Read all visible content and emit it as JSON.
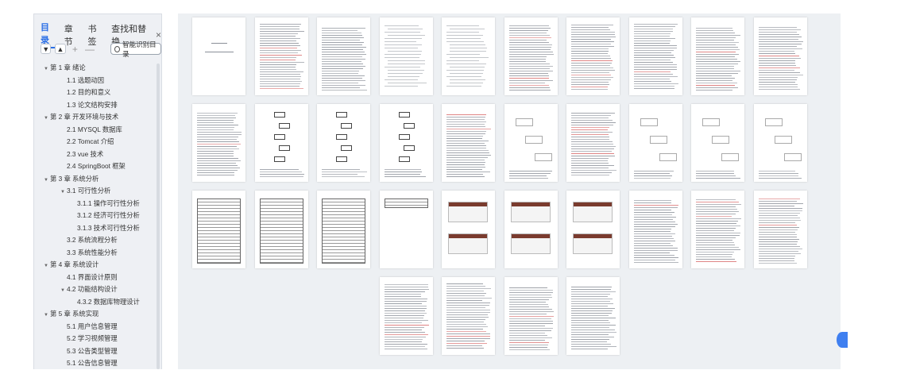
{
  "sidebar": {
    "tabs": [
      {
        "label": "目录",
        "active": true
      },
      {
        "label": "章节",
        "active": false
      },
      {
        "label": "书签",
        "active": false
      },
      {
        "label": "查找和替换",
        "active": false
      }
    ],
    "close_label": "×",
    "tools": {
      "expand_icon": "chevron-down-icon",
      "collapse_icon": "chevron-up-icon",
      "add_label": "+",
      "remove_label": "—",
      "smart_label": "智能识别目录"
    },
    "toc": [
      {
        "label": "第 1 章  绪论",
        "level": 0,
        "expanded": true
      },
      {
        "label": "1.1 选题动因",
        "level": 1
      },
      {
        "label": "1.2 目的和意义",
        "level": 1
      },
      {
        "label": "1.3 论文结构安排",
        "level": 1
      },
      {
        "label": "第 2 章  开发环境与技术",
        "level": 0,
        "expanded": true
      },
      {
        "label": "2.1 MYSQL 数据库",
        "level": 1
      },
      {
        "label": "2.2 Tomcat  介绍",
        "level": 1
      },
      {
        "label": "2.3 vue 技术",
        "level": 1
      },
      {
        "label": "2.4 SpringBoot 框架",
        "level": 1
      },
      {
        "label": "第 3 章  系统分析",
        "level": 0,
        "expanded": true
      },
      {
        "label": "3.1 可行性分析",
        "level": 1,
        "expanded": true
      },
      {
        "label": "3.1.1 操作可行性分析",
        "level": 2
      },
      {
        "label": "3.1.2 经济可行性分析",
        "level": 2
      },
      {
        "label": "3.1.3 技术可行性分析",
        "level": 2
      },
      {
        "label": "3.2 系统流程分析",
        "level": 1
      },
      {
        "label": "3.3 系统性能分析",
        "level": 1
      },
      {
        "label": "第 4 章  系统设计",
        "level": 0,
        "expanded": true
      },
      {
        "label": "4.1 界面设计原则",
        "level": 1
      },
      {
        "label": "4.2 功能结构设计",
        "level": 1,
        "expanded": true
      },
      {
        "label": "4.3.2  数据库物理设计",
        "level": 2
      },
      {
        "label": "第 5 章  系统实现",
        "level": 0,
        "expanded": true
      },
      {
        "label": "5.1 用户信息管理",
        "level": 1
      },
      {
        "label": "5.2  学习视频管理",
        "level": 1
      },
      {
        "label": "5.3 公告类型管理",
        "level": 1
      },
      {
        "label": "5.1 公告信息管理",
        "level": 1
      }
    ]
  },
  "pages": {
    "count": 34,
    "kinds": [
      "cover",
      "text",
      "text",
      "toc",
      "toc",
      "text",
      "text",
      "text",
      "text",
      "text",
      "text",
      "flow",
      "flow",
      "flow",
      "text",
      "tree",
      "text",
      "tree",
      "tree",
      "tree",
      "table",
      "table",
      "table",
      "table-small",
      "screenshot",
      "screenshot",
      "screenshot",
      "text",
      "text",
      "text",
      "text",
      "text",
      "text",
      "text"
    ]
  },
  "colors": {
    "accent": "#2b6fe6",
    "sidebar_bg": "#eef0f4",
    "canvas_bg": "#edf0f3",
    "side_dot": "#3f7ff0"
  }
}
